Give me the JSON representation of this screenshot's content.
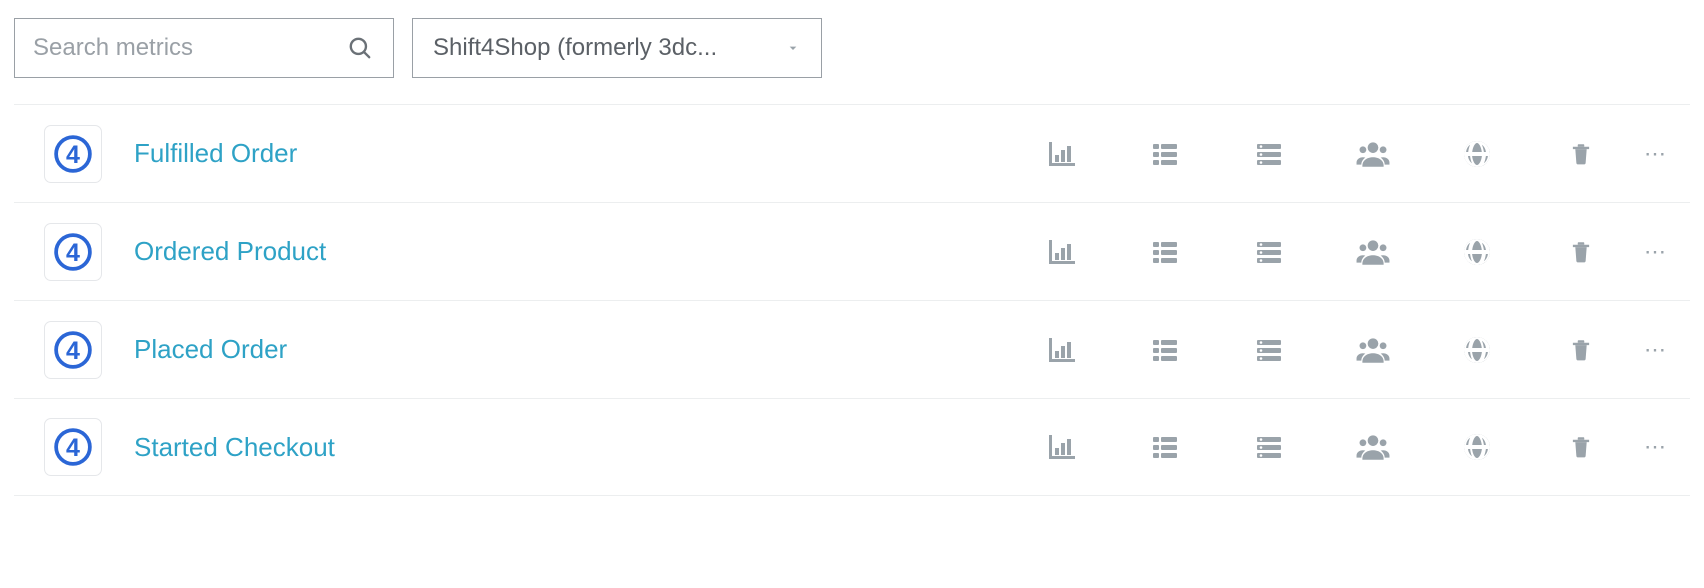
{
  "search": {
    "placeholder": "Search metrics"
  },
  "dropdown": {
    "label": "Shift4Shop (formerly 3dc..."
  },
  "metrics": [
    {
      "label": "Fulfilled Order"
    },
    {
      "label": "Ordered Product"
    },
    {
      "label": "Placed Order"
    },
    {
      "label": "Started Checkout"
    }
  ],
  "colors": {
    "link": "#2ea2c6",
    "icon": "#9aa3aa",
    "border": "#eceeef",
    "brand_ring": "#2b66d6"
  }
}
